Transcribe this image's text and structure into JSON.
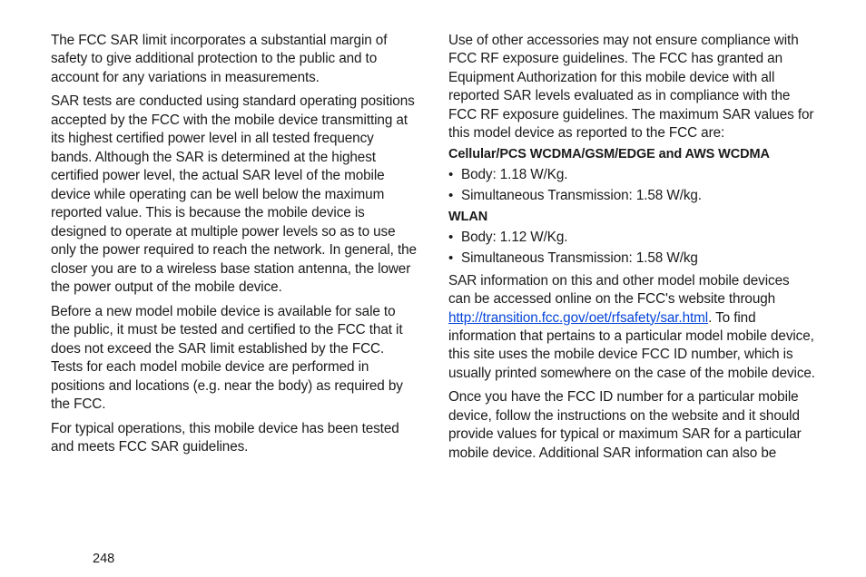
{
  "left_column": {
    "p1": "The FCC SAR limit incorporates a substantial margin of safety to give additional protection to the public and to account for any variations in measurements.",
    "p2": "SAR tests are conducted using standard operating positions accepted by the FCC with the mobile device transmitting at its highest certified power level in all tested frequency bands. Although the SAR is determined at the highest certified power level, the actual SAR level of the mobile device while operating can be well below the maximum reported value. This is because the mobile device is designed to operate at multiple power levels so as to use only the power required to reach the network. In general, the closer you are to a wireless base station antenna, the lower the power output of the mobile device.",
    "p3": "Before a new model mobile device is available for sale to the public, it must be tested and certified to the FCC that it does not exceed the SAR limit established by the FCC. Tests for each model mobile device are performed in positions and locations (e.g. near the body) as required by the FCC.",
    "p4": "For typical operations, this mobile device has been tested and meets FCC SAR guidelines."
  },
  "right_column": {
    "p1": "Use of other accessories may not ensure compliance with FCC RF exposure guidelines. The FCC has granted an Equipment Authorization for this mobile device with all reported SAR levels evaluated as in compliance with the FCC RF exposure guidelines. The maximum SAR values for this model device as reported to the FCC are:",
    "heading1": "Cellular/PCS WCDMA/GSM/EDGE and AWS WCDMA",
    "list1": {
      "item1": "Body: 1.18 W/Kg.",
      "item2": "Simultaneous Transmission: 1.58 W/kg."
    },
    "heading2": "WLAN",
    "list2": {
      "item1": "Body: 1.12 W/Kg.",
      "item2": "Simultaneous Transmission: 1.58 W/kg"
    },
    "p2_pre": "SAR information on this and other model mobile devices can be accessed online on the FCC's website through ",
    "link_text": "http://transition.fcc.gov/oet/rfsafety/sar.html",
    "link_href": "http://transition.fcc.gov/oet/rfsafety/sar.html",
    "p2_post": ". To find information that pertains to a particular model mobile device, this site uses the mobile device FCC ID number, which is usually printed somewhere on the case of the mobile device.",
    "p3": "Once you have the FCC ID number for a particular mobile device, follow the instructions on the website and it should provide values for typical or maximum SAR for a particular mobile device. Additional SAR information can also be"
  },
  "page_number": "248"
}
